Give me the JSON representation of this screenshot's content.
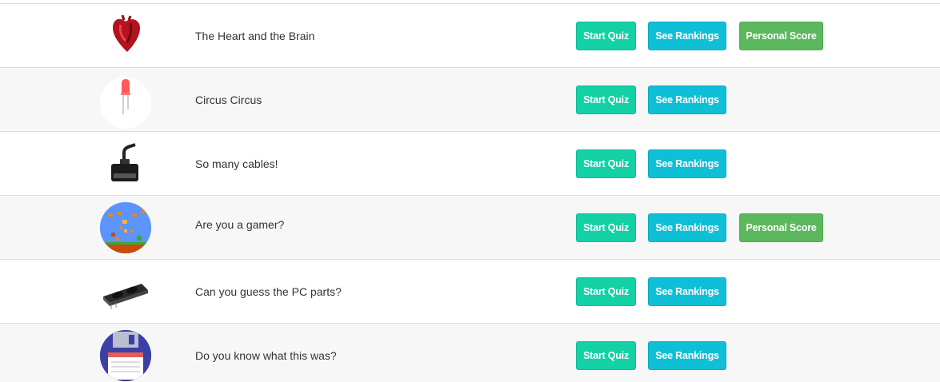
{
  "quizzes": [
    {
      "title": "The Heart and the Brain",
      "image_icon": "anatomical-heart-icon",
      "has_personal_score": true
    },
    {
      "title": "Circus Circus",
      "image_icon": "red-led-icon",
      "has_personal_score": false
    },
    {
      "title": "So many cables!",
      "image_icon": "cable-plug-icon",
      "has_personal_score": false
    },
    {
      "title": "Are you a gamer?",
      "image_icon": "pixel-game-scene-icon",
      "has_personal_score": true
    },
    {
      "title": "Can you guess the PC parts?",
      "image_icon": "graphics-card-icon",
      "has_personal_score": false
    },
    {
      "title": "Do you know what this was?",
      "image_icon": "floppy-disk-icon",
      "has_personal_score": false
    }
  ],
  "buttons": {
    "start": "Start Quiz",
    "rankings": "See Rankings",
    "personal_score": "Personal Score"
  },
  "colors": {
    "start_button": "#13d1a5",
    "rankings_button": "#0fbfd6",
    "personal_score_button": "#5cb85c",
    "striped_row": "#f7f7f7"
  }
}
